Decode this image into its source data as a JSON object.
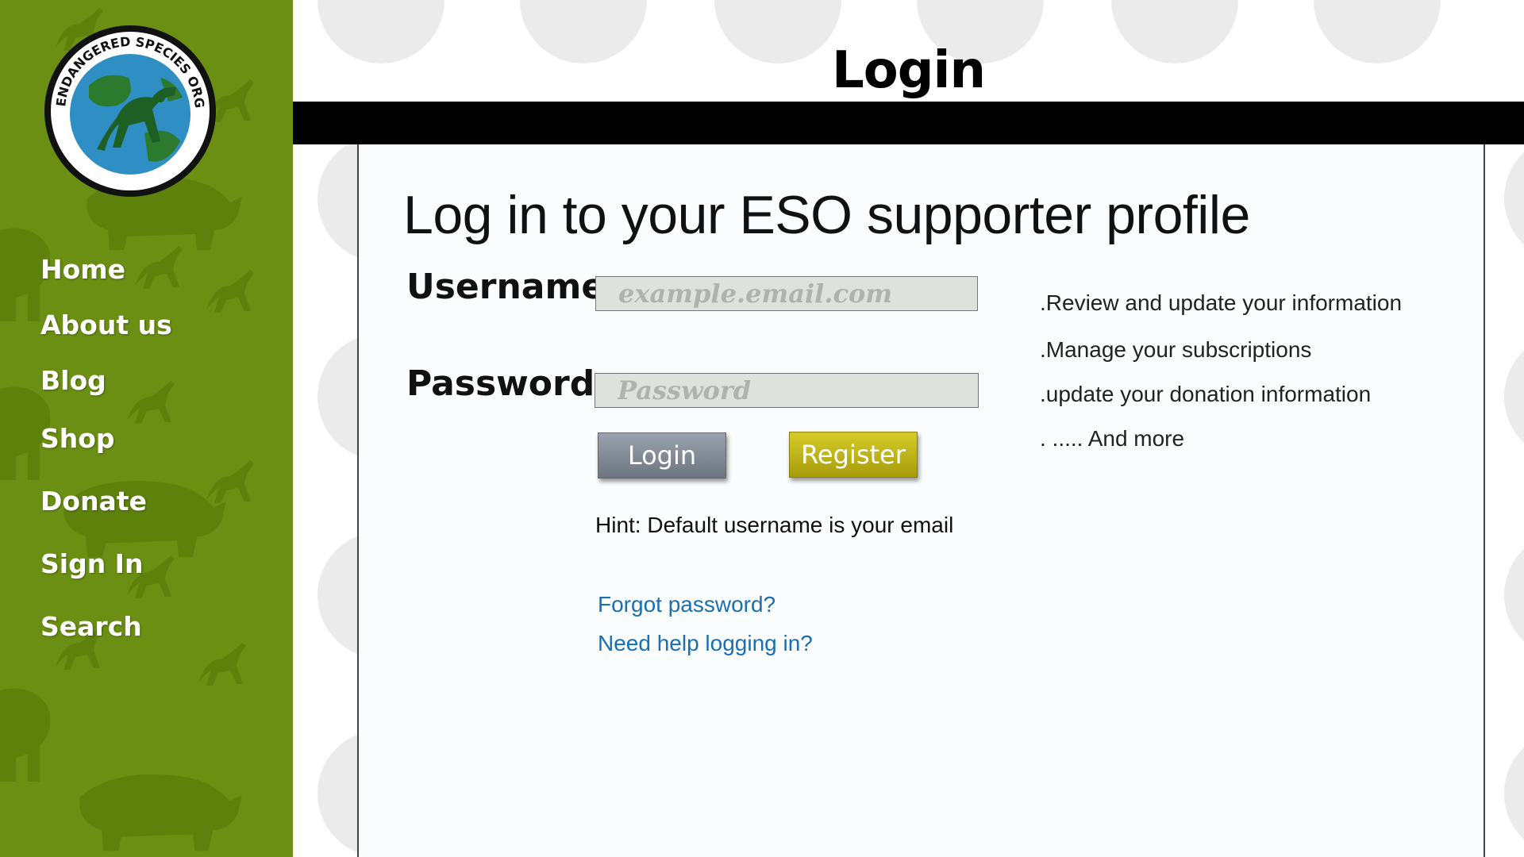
{
  "logo": {
    "text": "ENDANGERED SPECIES ORGANIZATION",
    "icon": "monkey-globe-logo"
  },
  "nav": {
    "items": [
      {
        "label": "Home"
      },
      {
        "label": "About us"
      },
      {
        "label": "Blog"
      },
      {
        "label": "Shop"
      },
      {
        "label": "Donate"
      },
      {
        "label": "Sign In"
      },
      {
        "label": "Search"
      }
    ]
  },
  "header": {
    "title": "Login"
  },
  "main": {
    "heading": "Log in to your ESO supporter profile",
    "username": {
      "label": "Username:",
      "placeholder": "example.email.com"
    },
    "password": {
      "label": "Password:",
      "placeholder": "Password"
    },
    "buttons": {
      "login": "Login",
      "register": "Register"
    },
    "hint": "Hint: Default username is your email",
    "links": {
      "forgot": "Forgot password?",
      "help": "Need help logging in?"
    },
    "benefits": [
      ".Review and update your information",
      ".Manage your subscriptions",
      ".update your donation information",
      ". ..... And more"
    ]
  },
  "colors": {
    "sidebar": "#6b8f12",
    "link": "#1a6fb2",
    "login_button": "#7d8690",
    "register_button": "#c2b71a"
  }
}
